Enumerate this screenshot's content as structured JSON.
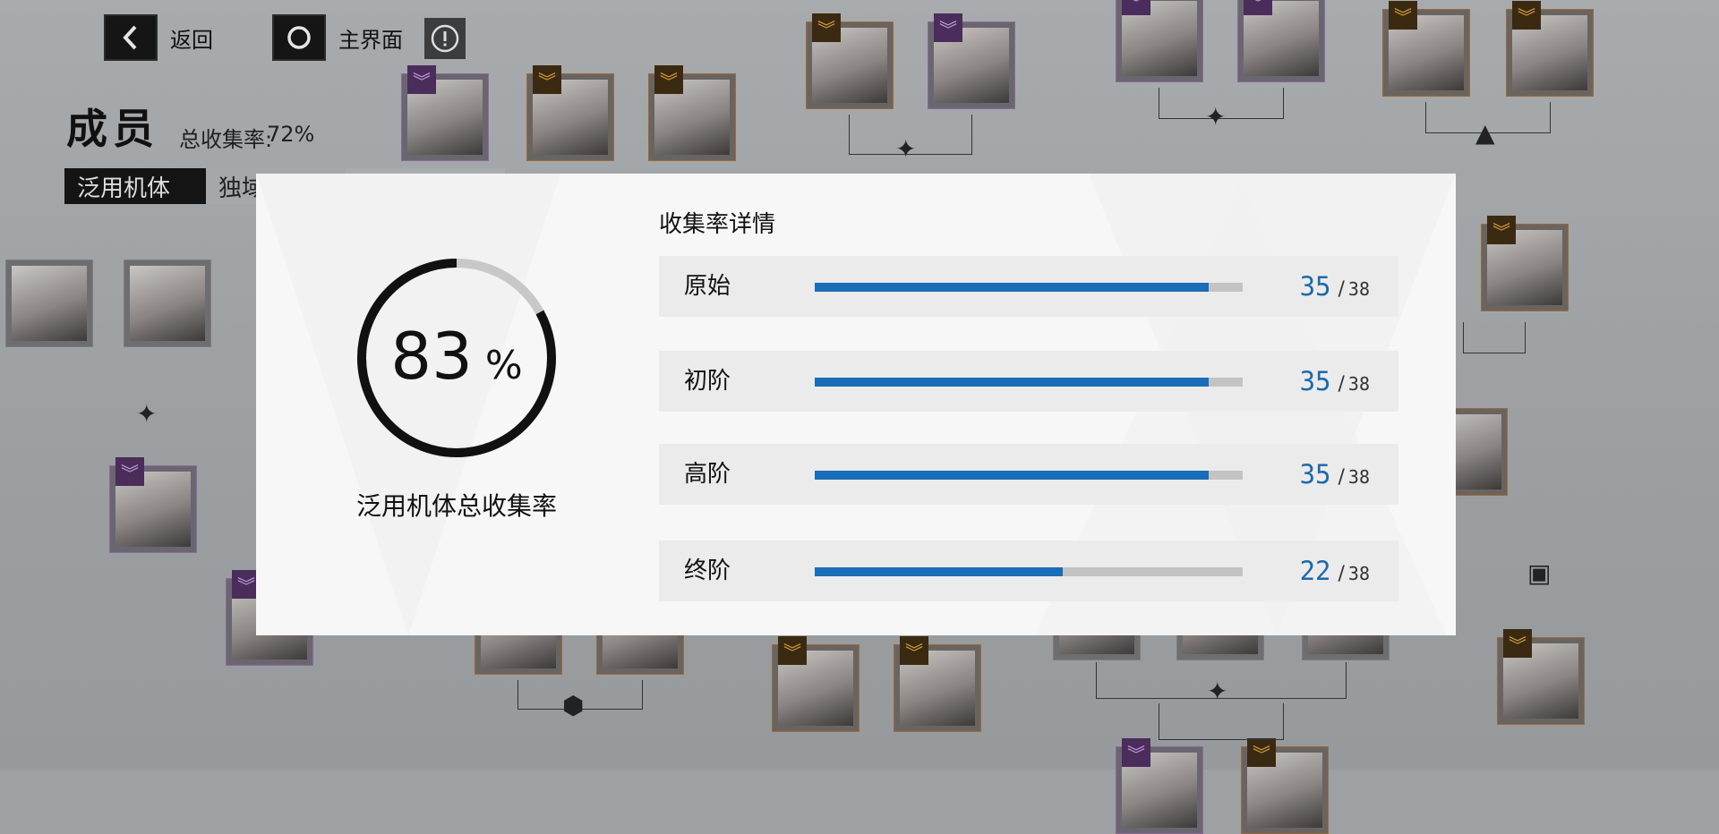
{
  "topbar": {
    "back_label": "返回",
    "home_label": "主界面",
    "icons": {
      "back": "chevron-left-icon",
      "home": "circle-icon",
      "info": "info-icon"
    }
  },
  "page": {
    "title": "成员",
    "total_rate_label": "总收集率:",
    "total_rate_value": "72%"
  },
  "tabs": [
    {
      "label": "泛用机体",
      "active": true
    },
    {
      "label": "独域",
      "active": false
    },
    {
      "label": "",
      "active": false
    }
  ],
  "modal": {
    "ring": {
      "percent_value": 83,
      "percent_text": "83",
      "percent_sign": "%",
      "caption": "泛用机体总收集率"
    },
    "details_title": "收集率详情",
    "rows": [
      {
        "label": "原始",
        "count": 35,
        "total": 38,
        "count_text": "35",
        "total_text": "38"
      },
      {
        "label": "初阶",
        "count": 35,
        "total": 38,
        "count_text": "35",
        "total_text": "38"
      },
      {
        "label": "高阶",
        "count": 35,
        "total": 38,
        "count_text": "35",
        "total_text": "38"
      },
      {
        "label": "终阶",
        "count": 22,
        "total": 38,
        "count_text": "22",
        "total_text": "38"
      }
    ],
    "colors": {
      "accent": "#1a6db8",
      "track": "#c3c3c3",
      "ring_fill": "#111111",
      "ring_track": "#c8c8c8"
    }
  },
  "separator": "/"
}
